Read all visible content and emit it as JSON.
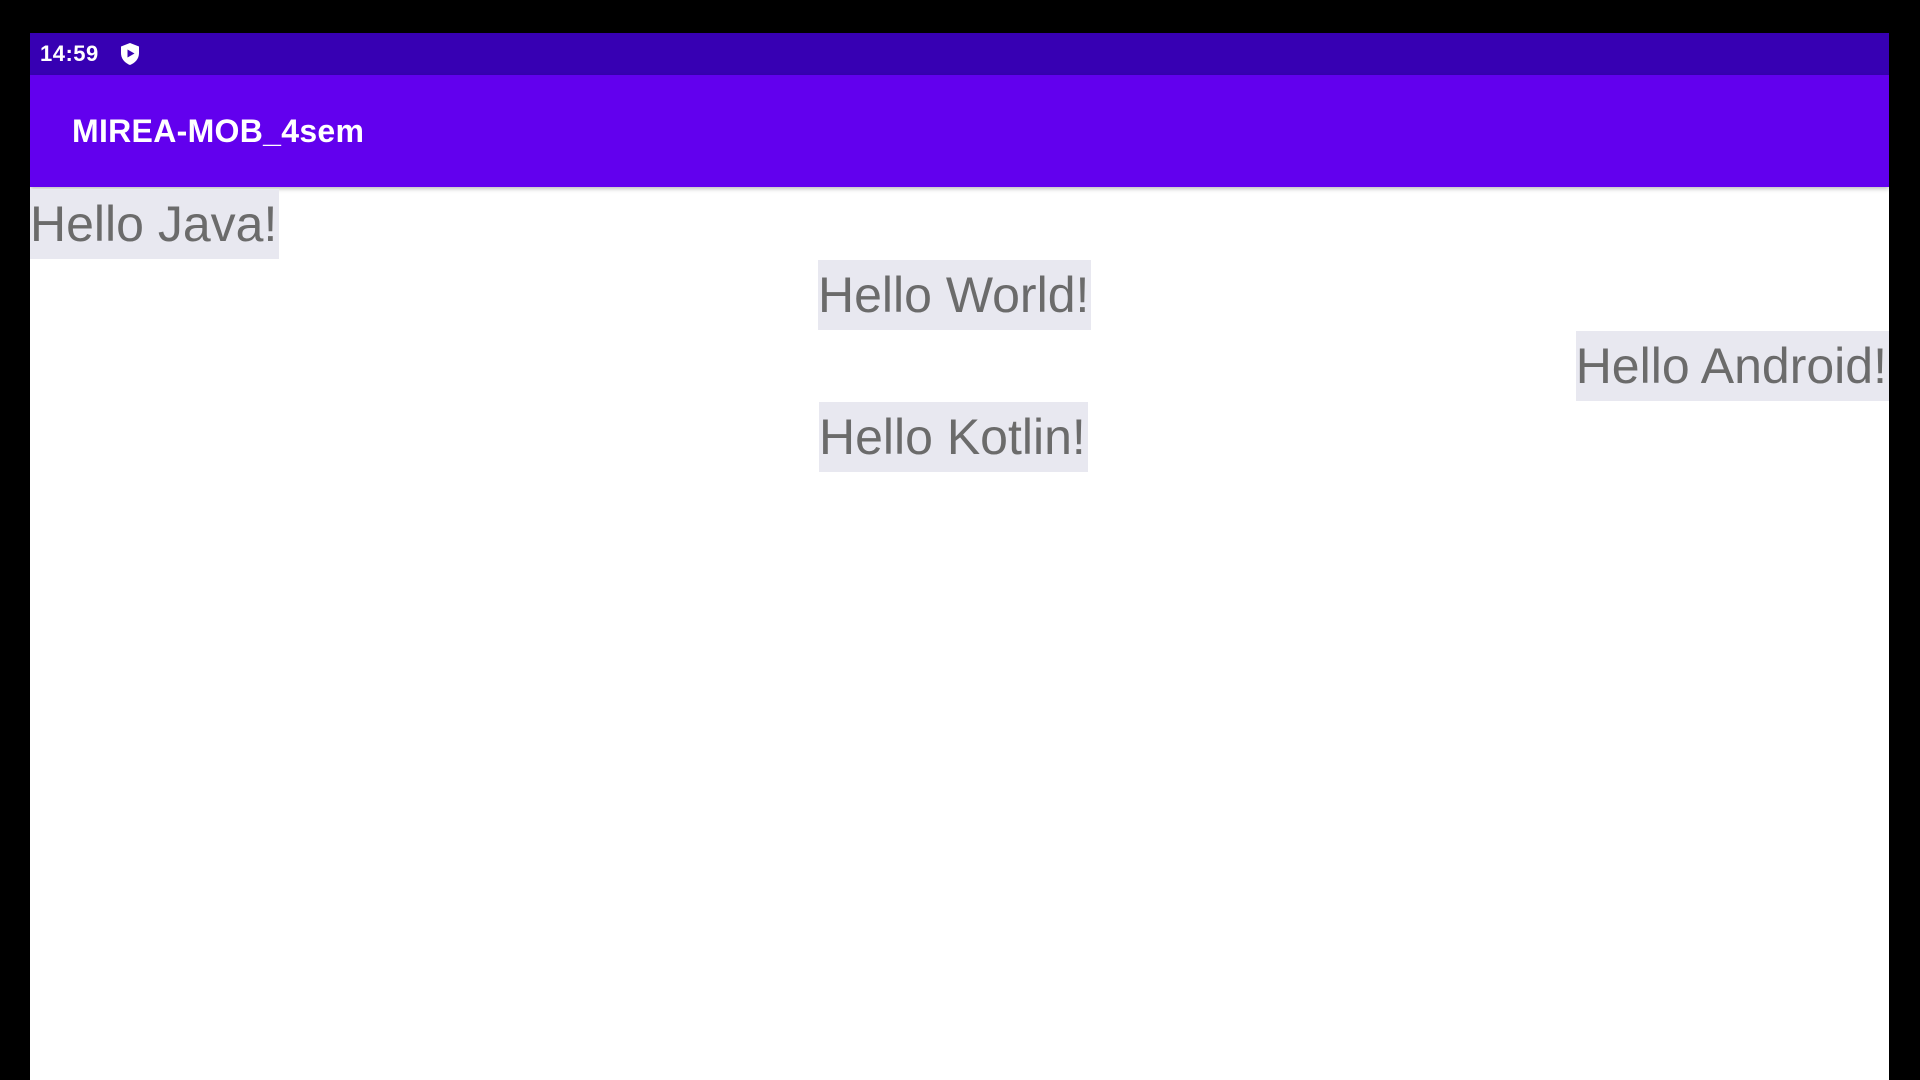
{
  "status_bar": {
    "time": "14:59",
    "icons": [
      "shield-icon"
    ]
  },
  "app_bar": {
    "title": "MIREA-MOB_4sem"
  },
  "content": {
    "texts": [
      "Hello Java!",
      "Hello World!",
      "Hello Android!",
      "Hello Kotlin!"
    ]
  },
  "colors": {
    "status_bar": "#3700b3",
    "app_bar": "#6200ee",
    "text_background": "#e8e8f0",
    "text_color": "#6b6b6b"
  }
}
